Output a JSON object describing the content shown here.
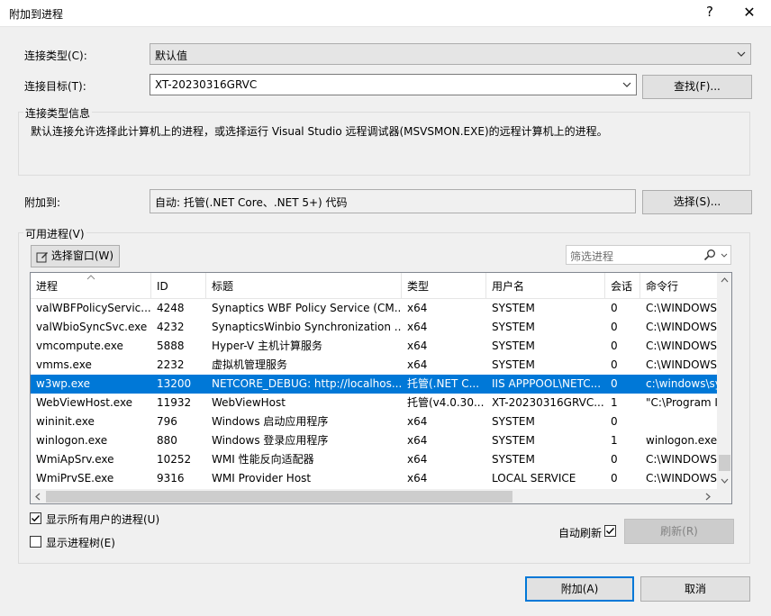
{
  "window": {
    "title": "附加到进程",
    "help": "?",
    "close": "✕"
  },
  "connection_type": {
    "label": "连接类型(C):",
    "value": "默认值"
  },
  "connection_target": {
    "label": "连接目标(T):",
    "value": "XT-20230316GRVC",
    "find_button": "查找(F)..."
  },
  "connection_info": {
    "label": "连接类型信息",
    "text": "默认连接允许选择此计算机上的进程，或选择运行 Visual Studio 远程调试器(MSVSMON.EXE)的远程计算机上的进程。"
  },
  "attach_to": {
    "label": "附加到:",
    "value": "自动: 托管(.NET Core、.NET 5+) 代码",
    "select_button": "选择(S)..."
  },
  "available": {
    "label": "可用进程(V)",
    "select_window_button": "选择窗口(W)",
    "filter_placeholder": "筛选进程"
  },
  "table": {
    "columns": [
      "进程",
      "ID",
      "标题",
      "类型",
      "用户名",
      "会话",
      "命令行"
    ],
    "rows": [
      [
        "valWBFPolicyServic...",
        "4248",
        "Synaptics WBF Policy Service (CM...",
        "x64",
        "SYSTEM",
        "0",
        "C:\\WINDOWS"
      ],
      [
        "valWbioSyncSvc.exe",
        "4232",
        "SynapticsWinbio Synchronization ...",
        "x64",
        "SYSTEM",
        "0",
        "C:\\WINDOWS"
      ],
      [
        "vmcompute.exe",
        "5888",
        "Hyper-V 主机计算服务",
        "x64",
        "SYSTEM",
        "0",
        "C:\\WINDOWS"
      ],
      [
        "vmms.exe",
        "2232",
        "虚拟机管理服务",
        "x64",
        "SYSTEM",
        "0",
        "C:\\WINDOWS"
      ],
      [
        "w3wp.exe",
        "13200",
        "NETCORE_DEBUG: http://localhos...",
        "托管(.NET C...",
        "IIS APPPOOL\\NETC...",
        "0",
        "c:\\windows\\sy"
      ],
      [
        "WebViewHost.exe",
        "11932",
        "WebViewHost",
        "托管(v4.0.30...",
        "XT-20230316GRVC...",
        "1",
        "\"C:\\Program I"
      ],
      [
        "wininit.exe",
        "796",
        "Windows 启动应用程序",
        "x64",
        "SYSTEM",
        "0",
        ""
      ],
      [
        "winlogon.exe",
        "880",
        "Windows 登录应用程序",
        "x64",
        "SYSTEM",
        "1",
        "winlogon.exe"
      ],
      [
        "WmiApSrv.exe",
        "10252",
        "WMI 性能反向适配器",
        "x64",
        "SYSTEM",
        "0",
        "C:\\WINDOWS"
      ],
      [
        "WmiPrvSE.exe",
        "9316",
        "WMI Provider Host",
        "x64",
        "LOCAL SERVICE",
        "0",
        "C:\\WINDOWS"
      ]
    ],
    "selected_index": 4
  },
  "options": {
    "show_all_users": "显示所有用户的进程(U)",
    "show_all_users_checked": true,
    "show_tree": "显示进程树(E)",
    "show_tree_checked": false,
    "auto_refresh": "自动刷新",
    "auto_refresh_checked": true,
    "refresh_button": "刷新(R)"
  },
  "footer": {
    "attach_button": "附加(A)",
    "cancel_button": "取消"
  },
  "colors": {
    "selection": "#0078d7",
    "accent": "#0078d7"
  }
}
